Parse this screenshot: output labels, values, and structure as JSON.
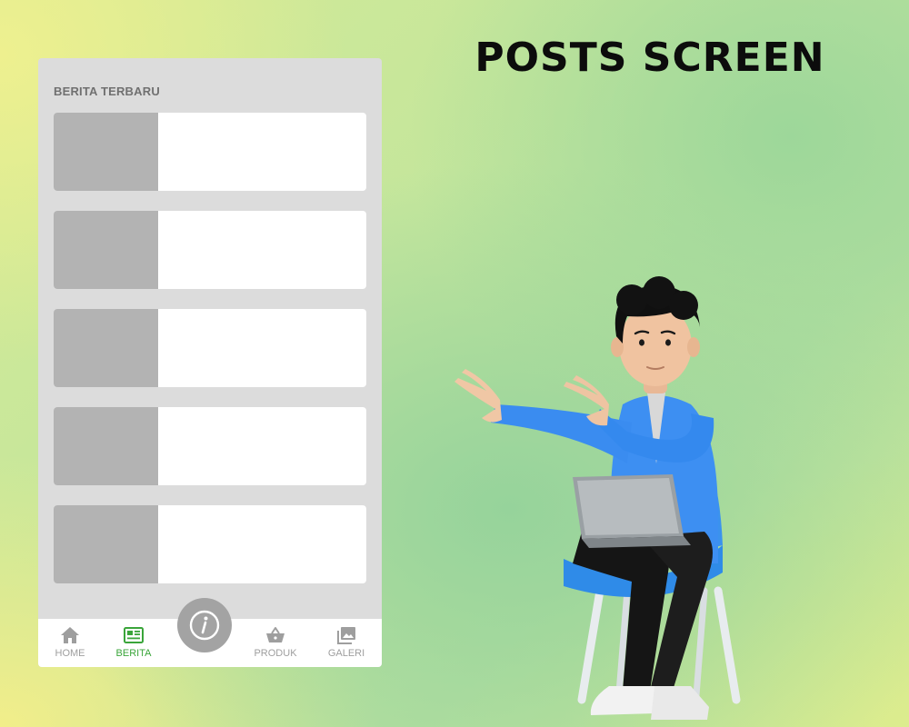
{
  "heading": "POSTS SCREEN",
  "screen": {
    "section_title": "BERITA TERBARU",
    "news_cards": [
      {
        "id": 1
      },
      {
        "id": 2
      },
      {
        "id": 3
      },
      {
        "id": 4
      },
      {
        "id": 5
      }
    ],
    "fab_icon": "info-icon",
    "nav": {
      "home": "HOME",
      "berita": "BERITA",
      "produk": "PRODUK",
      "galeri": "GALERI",
      "active": "BERITA"
    }
  },
  "colors": {
    "active_nav": "#3aa53a",
    "inactive_nav": "#9e9e9e",
    "placeholder_thumb": "#b3b3b3",
    "screen_bg": "#dcdcdc"
  }
}
